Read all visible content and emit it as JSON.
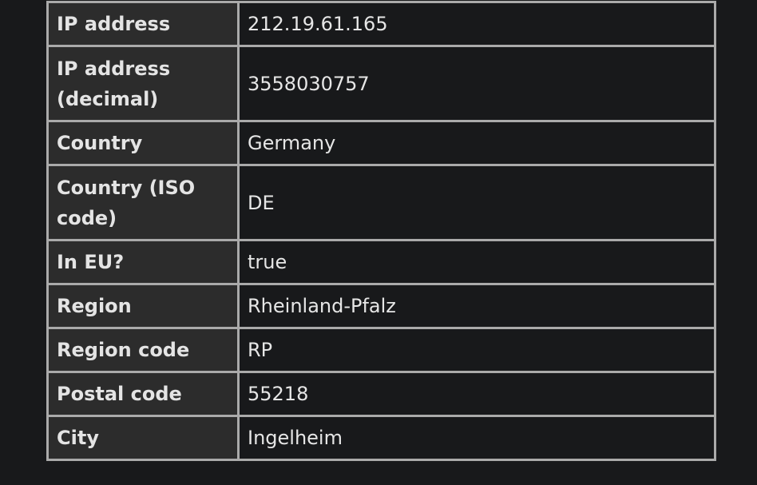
{
  "rows": [
    {
      "label": "IP address",
      "value": "212.19.61.165"
    },
    {
      "label": "IP address (decimal)",
      "value": "3558030757"
    },
    {
      "label": "Country",
      "value": "Germany"
    },
    {
      "label": "Country (ISO code)",
      "value": "DE"
    },
    {
      "label": "In EU?",
      "value": "true"
    },
    {
      "label": "Region",
      "value": "Rheinland-Pfalz"
    },
    {
      "label": "Region code",
      "value": "RP"
    },
    {
      "label": "Postal code",
      "value": "55218"
    },
    {
      "label": "City",
      "value": "Ingelheim"
    }
  ]
}
